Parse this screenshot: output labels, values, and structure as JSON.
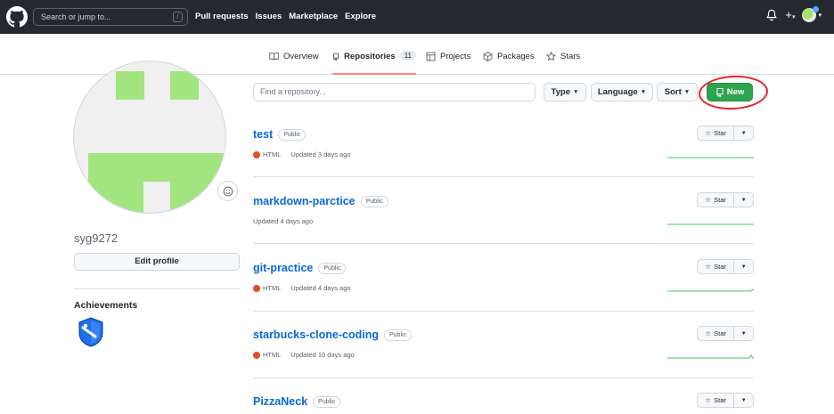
{
  "header": {
    "search_placeholder": "Search or jump to...",
    "search_shortcut": "/",
    "nav": [
      "Pull requests",
      "Issues",
      "Marketplace",
      "Explore"
    ],
    "plus": "+"
  },
  "tabs": [
    {
      "label": "Overview",
      "icon": "book-icon"
    },
    {
      "label": "Repositories",
      "icon": "repo-icon",
      "count": "11"
    },
    {
      "label": "Projects",
      "icon": "table-icon"
    },
    {
      "label": "Packages",
      "icon": "package-icon"
    },
    {
      "label": "Stars",
      "icon": "star-icon"
    }
  ],
  "profile": {
    "username": "syg9272",
    "edit_label": "Edit profile",
    "achievements_label": "Achievements"
  },
  "toolbar": {
    "find_placeholder": "Find a repository...",
    "type_label": "Type",
    "language_label": "Language",
    "sort_label": "Sort",
    "new_label": "New"
  },
  "colors": {
    "accent_green": "#2da44e",
    "link_blue": "#0969da",
    "html_lang": "#e34c26",
    "annotation_red": "#e3242b"
  },
  "repos": [
    {
      "name": "test",
      "visibility": "Public",
      "language": "HTML",
      "updated": "Updated 3 days ago",
      "star_label": "Star"
    },
    {
      "name": "markdown-parctice",
      "visibility": "Public",
      "language": "",
      "updated": "Updated 4 days ago",
      "star_label": "Star"
    },
    {
      "name": "git-practice",
      "visibility": "Public",
      "language": "HTML",
      "updated": "Updated 4 days ago",
      "star_label": "Star"
    },
    {
      "name": "starbucks-clone-coding",
      "visibility": "Public",
      "language": "HTML",
      "updated": "Updated 10 days ago",
      "star_label": "Star"
    },
    {
      "name": "PizzaNeck",
      "visibility": "Public",
      "language": "",
      "updated": "",
      "star_label": "Star"
    }
  ]
}
